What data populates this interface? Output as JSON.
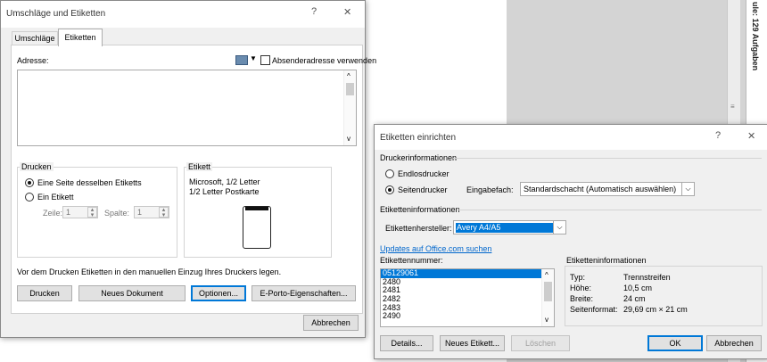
{
  "background": {
    "pane_vertical_text": "ule: 129 Aufgaben"
  },
  "envelopes_dialog": {
    "title": "Umschläge und Etiketten",
    "help_glyph": "?",
    "close_glyph": "✕",
    "tabs": [
      "Umschläge",
      "Etiketten"
    ],
    "address_label": "Adresse:",
    "sender_checkbox_label": "Absenderadresse verwenden",
    "print_group": {
      "label": "Drucken",
      "opt_full_page": "Eine Seite desselben Etiketts",
      "opt_single": "Ein Etikett",
      "row_label": "Zeile:",
      "row_value": "1",
      "col_label": "Spalte:",
      "col_value": "1"
    },
    "label_group": {
      "label": "Etikett",
      "line1": "Microsoft, 1/2 Letter",
      "line2": "1/2 Letter Postkarte"
    },
    "note": "Vor dem Drucken Etiketten in den manuellen Einzug Ihres Druckers legen.",
    "buttons": {
      "print": "Drucken",
      "new_document": "Neues Dokument",
      "options": "Optionen...",
      "eporto": "E-Porto-Eigenschaften...",
      "cancel": "Abbrechen"
    }
  },
  "label_setup_dialog": {
    "title": "Etiketten einrichten",
    "help_glyph": "?",
    "close_glyph": "✕",
    "printer_info_label": "Druckerinformationen",
    "continuous_printer": "Endlosdrucker",
    "page_printer": "Seitendrucker",
    "tray_label": "Eingabefach:",
    "tray_value": "Standardschacht (Automatisch auswählen)",
    "label_info_label": "Etiketteninformationen",
    "vendor_label": "Etikettenhersteller:",
    "vendor_value": "Avery A4/A5",
    "updates_link": "Updates auf Office.com suchen",
    "product_number_label": "Etikettennummer:",
    "product_numbers": [
      "05129061",
      "2480",
      "2481",
      "2482",
      "2483",
      "2490"
    ],
    "info_group_label": "Etiketteninformationen",
    "info": {
      "type_label": "Typ:",
      "type_value": "Trennstreifen",
      "height_label": "Höhe:",
      "height_value": "10,5 cm",
      "width_label": "Breite:",
      "width_value": "24 cm",
      "page_label": "Seitenformat:",
      "page_value": "29,69 cm × 21 cm"
    },
    "buttons": {
      "details": "Details...",
      "new_label": "Neues Etikett...",
      "delete": "Löschen",
      "ok": "OK",
      "cancel": "Abbrechen"
    }
  }
}
